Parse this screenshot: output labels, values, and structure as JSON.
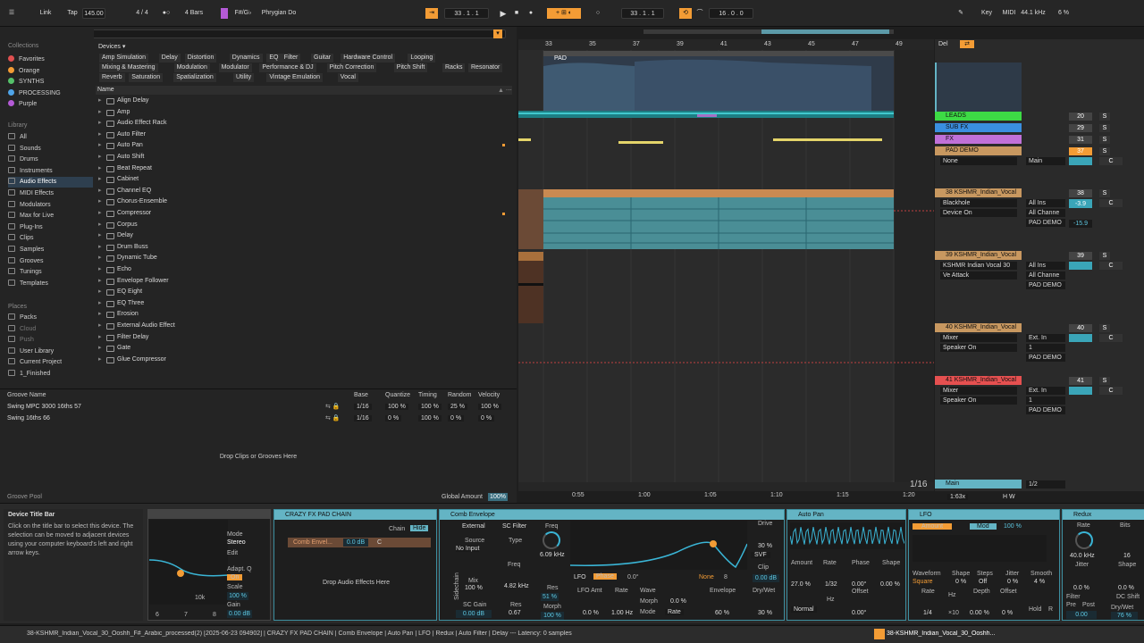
{
  "colors": {
    "accent": "#f39c35",
    "device": "#64b4c4",
    "selection": "#2e3f4f"
  },
  "topbar": {
    "link": "Link",
    "tap": "Tap",
    "tempo": "145.00",
    "sig": "4 / 4",
    "loop_len": "4 Bars",
    "key_root": "F#/G♭",
    "scale": "Phrygian Do",
    "pos": "33 .  1 .  1",
    "pos2": "33 .  1 .  1",
    "len": "16 .  0 .  0",
    "key": "Key",
    "midi": "MIDI",
    "rate": "44.1 kHz",
    "cpu": "6 %"
  },
  "browser": {
    "search_placeholder": "Search (Cmd + F)",
    "collections_hdr": "Collections",
    "collections": [
      {
        "label": "Favorites",
        "color": "#e05050"
      },
      {
        "label": "Orange",
        "color": "#f39c35"
      },
      {
        "label": "SYNTHS",
        "color": "#55c16a"
      },
      {
        "label": "PROCESSING",
        "color": "#4fa4e8"
      },
      {
        "label": "Purple",
        "color": "#b45ad6"
      }
    ],
    "library_hdr": "Library",
    "library": [
      "All",
      "Sounds",
      "Drums",
      "Instruments",
      "Audio Effects",
      "MIDI Effects",
      "Modulators",
      "Max for Live",
      "Plug-Ins",
      "Clips",
      "Samples",
      "Grooves",
      "Tunings",
      "Templates"
    ],
    "places_hdr": "Places",
    "places": [
      "Packs",
      "Cloud",
      "Push",
      "User Library",
      "Current Project",
      "1_Finished"
    ],
    "devices_label": "Devices ▾",
    "tags": [
      "Amp Simulation",
      "Delay",
      "Distortion",
      "Dynamics",
      "EQ",
      "Filter",
      "Guitar",
      "Hardware Control",
      "Looping",
      "Mixing & Mastering",
      "Modulation",
      "Modulator",
      "Performance & DJ",
      "Pitch Correction",
      "Pitch Shift",
      "Racks",
      "Resonator",
      "Reverb",
      "Saturation",
      "Spatialization",
      "Utility",
      "Vintage Emulation",
      "Vocal"
    ],
    "name_hdr": "Name",
    "items": [
      "Align Delay",
      "Amp",
      "Audio Effect Rack",
      "Auto Filter",
      "Auto Pan",
      "Auto Shift",
      "Beat Repeat",
      "Cabinet",
      "Channel EQ",
      "Chorus-Ensemble",
      "Compressor",
      "Corpus",
      "Delay",
      "Drum Buss",
      "Dynamic Tube",
      "Echo",
      "Envelope Follower",
      "EQ Eight",
      "EQ Three",
      "Erosion",
      "External Audio Effect",
      "Filter Delay",
      "Gate",
      "Glue Compressor"
    ]
  },
  "groove": {
    "hdr": "Groove Name",
    "cols": [
      "Base",
      "Quantize",
      "Timing",
      "Random",
      "Velocity"
    ],
    "rows": [
      {
        "name": "Swing MPC 3000 16ths 57",
        "base": "1/16",
        "q": "100 %",
        "t": "100 %",
        "r": "25 %",
        "v": "100 %"
      },
      {
        "name": "Swing 16ths 66",
        "base": "1/16",
        "q": "0 %",
        "t": "100 %",
        "r": "0 %",
        "v": "0 %"
      }
    ],
    "drop": "Drop Clips or Grooves Here",
    "pool": "Groove Pool",
    "global": "Global Amount",
    "global_val": "100%"
  },
  "arrangement": {
    "bars": [
      "33",
      "35",
      "37",
      "39",
      "41",
      "43",
      "45",
      "47",
      "49"
    ],
    "clip": "PAD",
    "times": [
      "0:55",
      "1:00",
      "1:05",
      "1:10",
      "1:15",
      "1:20"
    ],
    "quant": "1/16",
    "zoom": "1:63x"
  },
  "mixer": {
    "del": "Del",
    "tracks": [
      {
        "name": "LEADS",
        "color": "#3ddb45",
        "num": "20",
        "sub": []
      },
      {
        "name": "SUB FX",
        "color": "#3a8fe0",
        "num": "29",
        "sub": []
      },
      {
        "name": "FX",
        "color": "#c070d8",
        "num": "31",
        "sub": []
      },
      {
        "name": "PAD DEMO",
        "color": "#c89860",
        "num": "37",
        "sub": [
          "None",
          "Main"
        ]
      },
      {
        "name": "38 KSHMR_Indian_Vocal",
        "color": "#c89860",
        "num": "38",
        "sub": [
          "Blackhole",
          "Device On",
          "All Ins",
          "All Channe",
          "PAD DEMO"
        ]
      },
      {
        "name": "39 KSHMR_Indian_Vocal",
        "color": "#c89860",
        "num": "39",
        "sub": [
          "KSHMR Indian Vocal 30",
          "Ve Attack",
          "All Ins",
          "All Channe",
          "PAD DEMO"
        ]
      },
      {
        "name": "40 KSHMR_Indian_Vocal",
        "color": "#c89860",
        "num": "40",
        "sub": [
          "Mixer",
          "Speaker On",
          "Ext. In",
          "1",
          "PAD DEMO"
        ]
      },
      {
        "name": "41 KSHMR_Indian_Vocal",
        "color": "#e55050",
        "num": "41",
        "sub": [
          "Mixer",
          "Speaker On",
          "Ext. In",
          "1",
          "PAD DEMO"
        ]
      }
    ],
    "main": "Main",
    "main_q": "1/2",
    "vals": [
      "-3.9",
      "-15.9"
    ]
  },
  "info": {
    "title": "Device Title Bar",
    "body": "Click on the title bar to select this device. The selection can be moved to adjacent devices using your computer keyboard's left and right arrow keys."
  },
  "eq": {
    "mode": "Mode",
    "mode_val": "Stereo",
    "edit": "Edit",
    "adapt": "Adapt. Q",
    "adapt_val": "On",
    "scale": "Scale",
    "scale_val": "100 %",
    "gain": "Gain",
    "gain_val": "0.00 dB",
    "freq_lbl": "10k",
    "bands": [
      "6",
      "7",
      "8"
    ]
  },
  "rack": {
    "title": "CRAZY FX PAD CHAIN",
    "chain": "Chain",
    "hide": "Hide",
    "chain_name": "Comb Envel...",
    "chain_db": "0.0 dB",
    "chain_c": "C",
    "drop": "Drop Audio Effects Here"
  },
  "comb": {
    "title": "Comb Envelope",
    "external": "External",
    "sc_filter": "SC Filter",
    "source": "Source",
    "source_val": "No Input",
    "type": "Type",
    "freq": "Freq",
    "freq_val": "4.82 kHz",
    "mix": "Mix",
    "mix_val": "100 %",
    "sc_gain": "SC Gain",
    "sc_gain_val": "0.00 dB",
    "res": "Res",
    "res_val": "0.67",
    "sidechain": "Sidechain",
    "f1": "Freq",
    "f1_val": "6.09 kHz",
    "res2": "Res",
    "res2_val": "51 %",
    "morph": "Morph",
    "morph_val": "100 %",
    "lfo": "LFO",
    "phase": "Phase",
    "phase_val": "0.0°",
    "drive": "Drive",
    "drive_val": "30 %",
    "svf": "SVF",
    "clip": "Clip",
    "clip_val": "0.00 dB",
    "none": "None",
    "eight": "8",
    "lfo_amt": "LFO Amt",
    "lfo_amt_val": "0.0 %",
    "rate": "Rate",
    "rate_val": "1.00 Hz",
    "wave": "Wave",
    "morph2": "Morph",
    "morph2_val": "0.0 %",
    "mode": "Mode",
    "mode_val": "Rate",
    "env": "Envelope",
    "env_val": "60 %",
    "drywet": "Dry/Wet",
    "drywet_val": "30 %"
  },
  "autopan": {
    "title": "Auto Pan",
    "amount": "Amount",
    "amount_val": "27.0 %",
    "rate": "Rate",
    "rate_val": "1/32",
    "phase": "Phase",
    "phase_val": "0.00°",
    "shape": "Shape",
    "shape_val": "0.00 %",
    "normal": "Normal",
    "offset": "Offset",
    "offset_val": "0.00°",
    "hz": "Hz"
  },
  "lfo": {
    "title": "LFO",
    "amount": "Amount",
    "mod": "Mod",
    "pct": "100 %",
    "waveform": "Waveform",
    "wave_val": "Square",
    "shape": "Shape",
    "shape_val": "0 %",
    "steps": "Steps",
    "steps_val": "Off",
    "jitter": "Jitter",
    "jitter_val": "0 %",
    "smooth": "Smooth",
    "smooth_val": "4 %",
    "rate": "Rate",
    "rate_val": "1/4",
    "hz": "Hz",
    "x10": "×10",
    "depth": "Depth",
    "depth_val": "0.00 %",
    "offset": "Offset",
    "offset_val": "0 %",
    "hold": "Hold",
    "r": "R"
  },
  "redux": {
    "title": "Redux",
    "rate": "Rate",
    "rate_val": "40.0 kHz",
    "bits": "Bits",
    "bits_val": "16",
    "jitter": "Jitter",
    "jitter_val": "0.0 %",
    "shape": "Shape",
    "shape_val": "0.0 %",
    "filter": "Filter",
    "pre": "Pre",
    "post": "Post",
    "dc": "DC Shift",
    "dc_val": "0.00",
    "drywet": "Dry/Wet",
    "drywet_val": "76 %",
    "f_val": "0.00"
  },
  "status": {
    "text": "38-KSHMR_Indian_Vocal_30_Ooshh_F#_Arabic_processed(2) [2025-06-23 094902] | CRAZY FX PAD CHAIN | Comb Envelope | Auto Pan | LFO | Redux | Auto Filter | Delay --- Latency: 0 samples",
    "track": "38-KSHMR_Indian_Vocal_30_Ooshh..."
  }
}
